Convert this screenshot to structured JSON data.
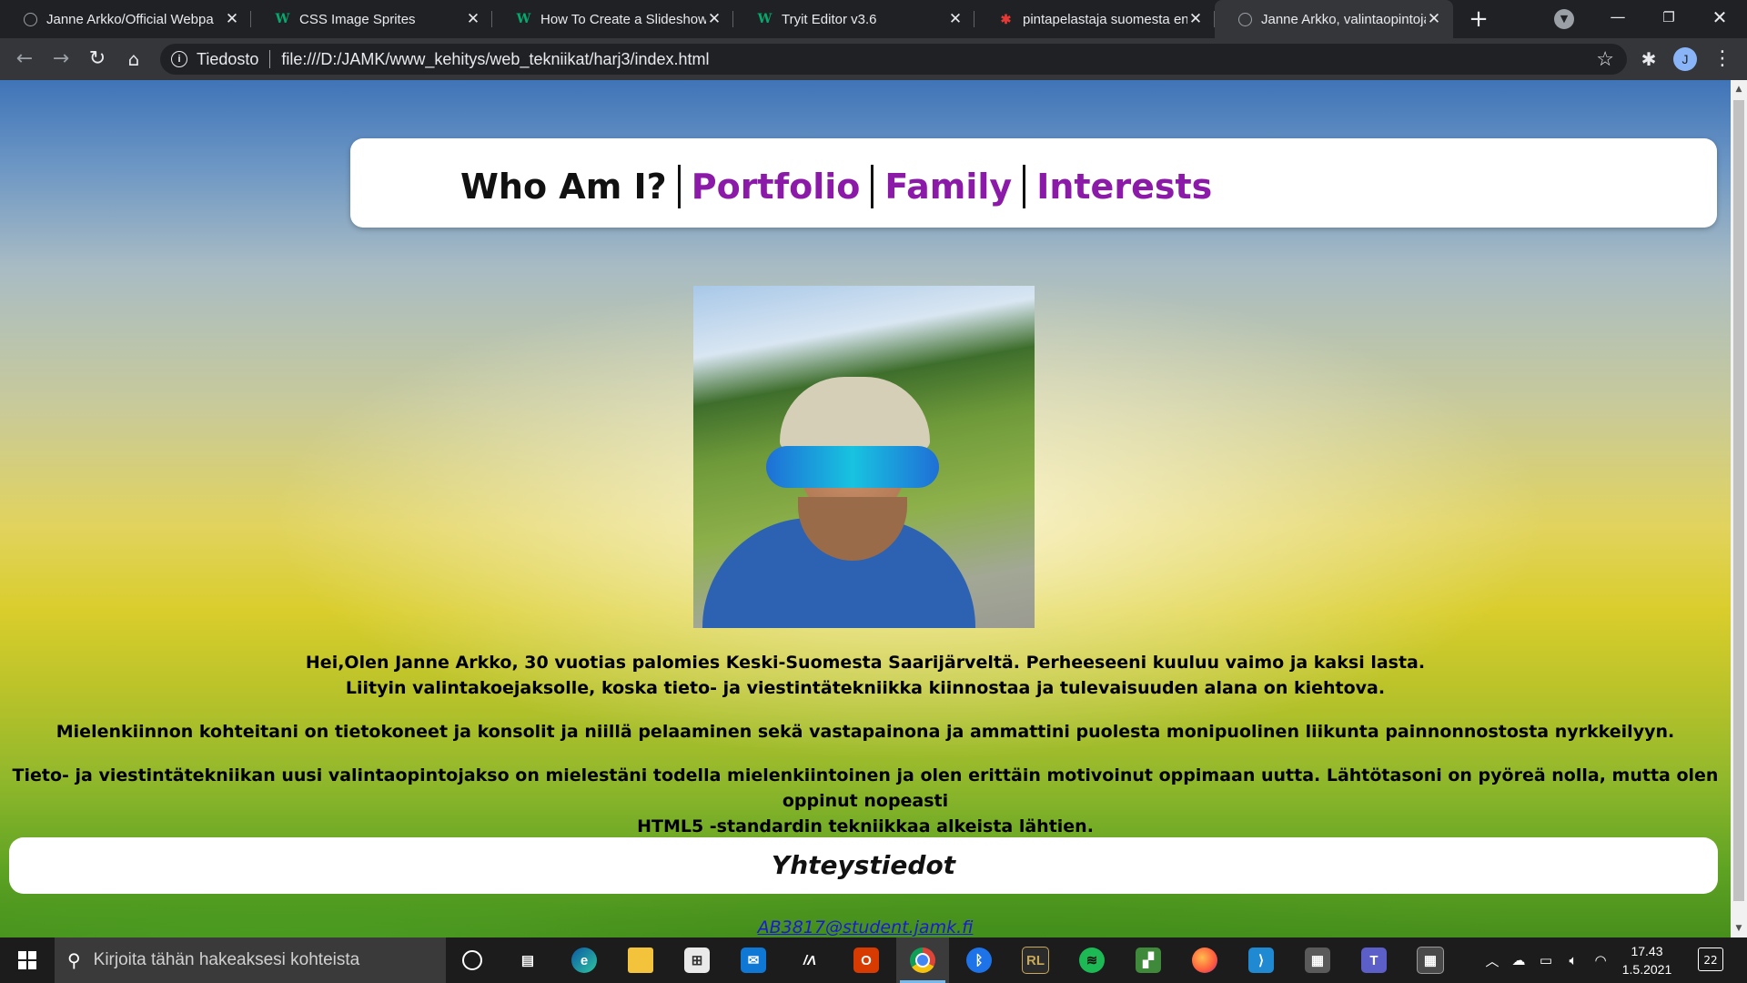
{
  "browser": {
    "tabs": [
      {
        "title": "Janne Arkko/Official Webpa",
        "icon": "globe-icon",
        "close": "✕"
      },
      {
        "title": "CSS Image Sprites",
        "icon": "w3schools-icon",
        "close": "✕"
      },
      {
        "title": "How To Create a Slideshow",
        "icon": "w3schools-icon",
        "close": "✕"
      },
      {
        "title": "Tryit Editor v3.6",
        "icon": "w3schools-icon",
        "close": "✕"
      },
      {
        "title": "pintapelastaja suomesta en",
        "icon": "translator-icon",
        "close": "✕"
      },
      {
        "title": "Janne Arkko, valintaopintoja",
        "icon": "globe-icon",
        "close": "✕",
        "active": true
      }
    ],
    "new_tab": "+",
    "omnibox": {
      "security_label": "Tiedosto",
      "url": "file:///D:/JAMK/www_kehitys/web_tekniikat/harj3/index.html"
    },
    "profile_initial": "J"
  },
  "page": {
    "menu": [
      {
        "label": "Who Am I?",
        "current": true
      },
      {
        "label": "Portfolio",
        "current": false
      },
      {
        "label": "Family",
        "current": false
      },
      {
        "label": "Interests",
        "current": false
      }
    ],
    "bio": {
      "p1_line1": "Hei,Olen Janne Arkko, 30 vuotias palomies Keski-Suomesta Saarijärveltä. Perheeseeni kuuluu vaimo ja kaksi lasta.",
      "p1_line2": "Liityin valintakoejaksolle, koska tieto- ja viestintätekniikka kiinnostaa ja tulevaisuuden alana on kiehtova.",
      "p2": "Mielenkiinnon kohteitani on tietokoneet ja konsolit ja niillä pelaaminen sekä vastapainona ja ammattini puolesta monipuolinen liikunta painnonnostosta nyrkkeilyyn.",
      "p3_line1": "Tieto- ja viestintätekniikan uusi valintaopintojakso on mielestäni todella mielenkiintoinen ja olen erittäin motivoinut oppimaan uutta. Lähtötasoni on pyöreä nolla, mutta olen oppinut nopeasti",
      "p3_line2": "HTML5 -standardin tekniikkaa alkeista lähtien."
    },
    "contact_title": "Yhteystiedot",
    "email": "AB3817@student.jamk.fi"
  },
  "taskbar": {
    "search_placeholder": "Kirjoita tähän hakeaksesi kohteista",
    "time": "17.43",
    "date": "1.5.2021",
    "notification_count": "22",
    "pinned": [
      "cortana-icon",
      "task-view-icon",
      "edge-icon",
      "file-explorer-icon",
      "store-icon",
      "mail-icon",
      "pen-app-icon",
      "office-icon",
      "chrome-icon",
      "bluetooth-app-icon",
      "rl-app-icon",
      "spotify-icon",
      "image-editor-icon",
      "firefox-icon",
      "vscode-icon",
      "network-app-icon",
      "teams-icon",
      "calculator-icon"
    ]
  },
  "colors": {
    "menu_link": "#8b1aa8",
    "email_link": "#1a1ad6",
    "chrome_dark": "#202124"
  }
}
